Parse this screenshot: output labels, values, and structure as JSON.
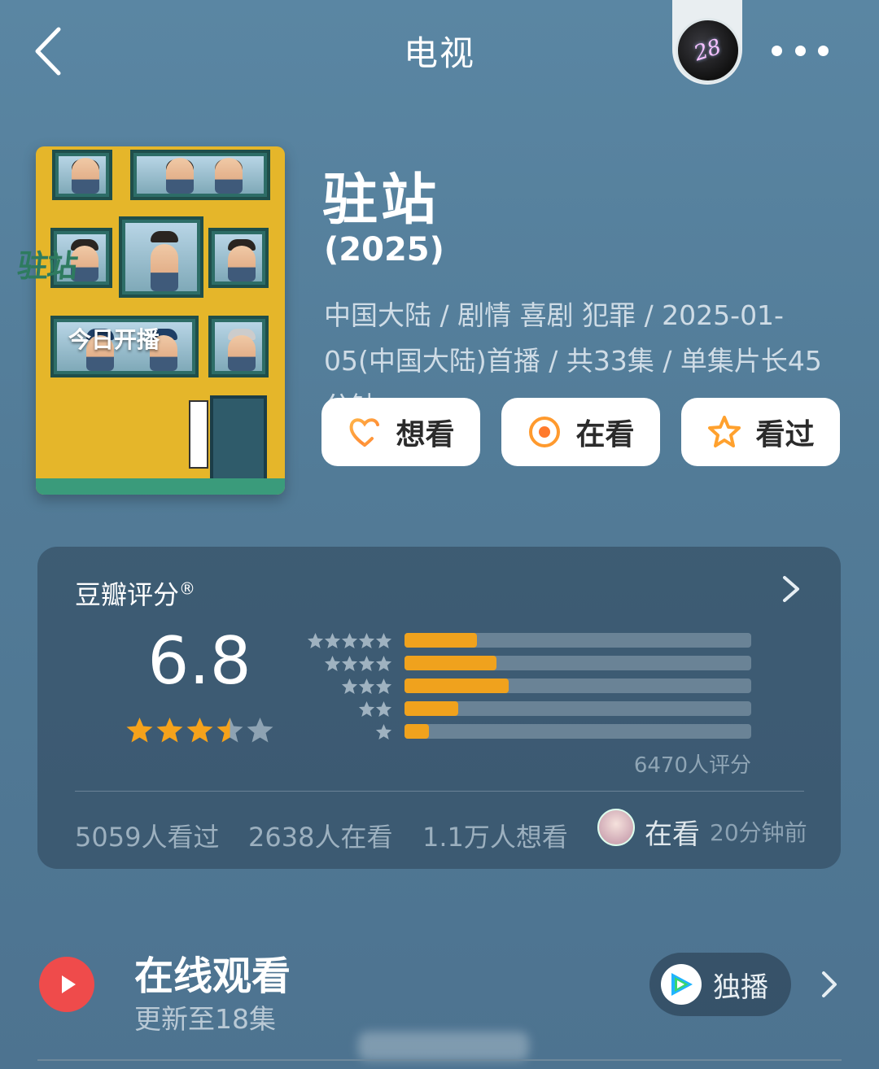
{
  "header": {
    "title": "电视",
    "avatar_text": "28"
  },
  "poster": {
    "title_art": "驻站",
    "badge": "今日开播"
  },
  "show": {
    "title": "驻站",
    "year": "(2025)",
    "meta": "中国大陆 / 剧情 喜剧 犯罪 / 2025-01-05(中国大陆)首播 / 共33集 / 单集片长45分钟",
    "meta_chevron": "›"
  },
  "actions": {
    "want": "想看",
    "watching": "在看",
    "watched": "看过"
  },
  "rating": {
    "label": "豆瓣评分",
    "registered": "®",
    "score": "6.8",
    "stars_filled": 3.5,
    "stars_total": 5,
    "distribution": [
      {
        "stars": 5,
        "fraction": 0.21
      },
      {
        "stars": 4,
        "fraction": 0.265
      },
      {
        "stars": 3,
        "fraction": 0.3
      },
      {
        "stars": 2,
        "fraction": 0.155
      },
      {
        "stars": 1,
        "fraction": 0.07
      }
    ],
    "total": "6470人评分",
    "watched_count": "5059人看过",
    "watching_count": "2638人在看",
    "want_count": "1.1万人想看",
    "friend_status": "在看",
    "friend_time": "20分钟前"
  },
  "online": {
    "title": "在线观看",
    "subtitle": "更新至18集",
    "exclusive": "独播"
  },
  "colors": {
    "accent_orange": "#f0a21d",
    "play_red": "#ef4b4b",
    "background": "#5a86a3"
  }
}
